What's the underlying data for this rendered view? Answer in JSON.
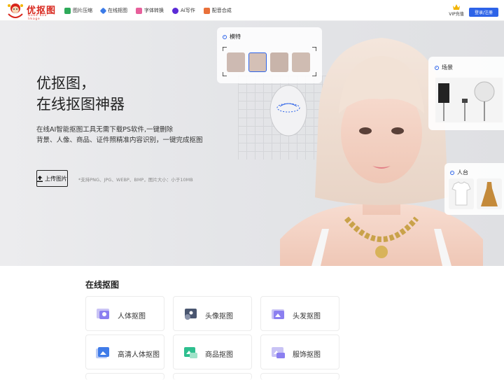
{
  "header": {
    "logo_text": "优抠图",
    "logo_sub": "Good Kou Image",
    "nav": [
      {
        "label": "图片压缩",
        "icon": "image-compress-icon",
        "color": "#2eaa5a"
      },
      {
        "label": "在线抠图",
        "icon": "online-matting-icon",
        "color": "#3b7be8"
      },
      {
        "label": "字体转换",
        "icon": "font-convert-icon",
        "color": "#e75f9b"
      },
      {
        "label": "Ai写作",
        "icon": "ai-writing-icon",
        "color": "#5b2bd6"
      },
      {
        "label": "配音合成",
        "icon": "voice-synthesis-icon",
        "color": "#e9703a"
      }
    ],
    "vip_label": "VIP充值",
    "login_label": "登录/注册"
  },
  "hero": {
    "title_line1": "优抠图，",
    "title_line2": "在线抠图神器",
    "desc_line1": "在线AI智能抠图工具无需下载PS软件,一键删除",
    "desc_line2": "背景、人像、商品、证件照精准内容识别，一键完成抠图",
    "upload_label": "上传图片",
    "upload_note": "*支持PNG、JPG、WEBP、BMP，图片大小：小于10MB",
    "card_model_label": "模特",
    "card_scene_label": "场景",
    "card_stand_label": "人台"
  },
  "online": {
    "title": "在线抠图",
    "tools": [
      {
        "label": "人体抠图",
        "icon": "body-matting-icon"
      },
      {
        "label": "头像抠图",
        "icon": "avatar-matting-icon"
      },
      {
        "label": "头发抠图",
        "icon": "hair-matting-icon"
      },
      {
        "label": "高清人体抠图",
        "icon": "hd-body-matting-icon"
      },
      {
        "label": "商品抠图",
        "icon": "product-matting-icon"
      },
      {
        "label": "服饰抠图",
        "icon": "clothing-matting-icon"
      }
    ]
  },
  "colors": {
    "accent": "#2d63e8",
    "brand": "#d8261c"
  }
}
